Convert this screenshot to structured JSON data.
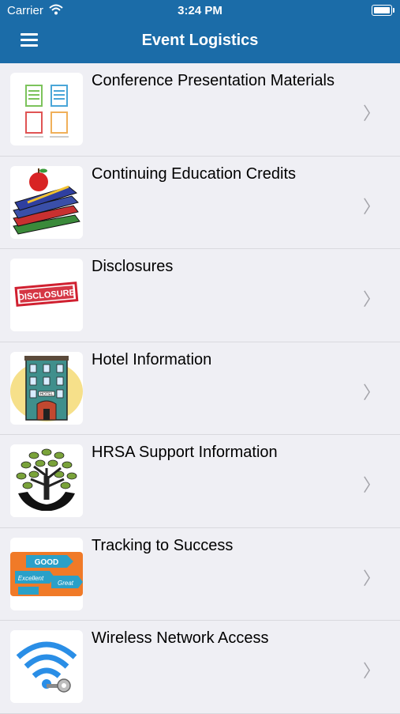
{
  "status_bar": {
    "carrier": "Carrier",
    "time": "3:24 PM"
  },
  "header": {
    "title": "Event Logistics"
  },
  "items": [
    {
      "label": "Conference Presentation Materials"
    },
    {
      "label": "Continuing Education Credits"
    },
    {
      "label": "Disclosures",
      "badge": "DISCLOSURE"
    },
    {
      "label": "Hotel Information",
      "sign": "HOTEL"
    },
    {
      "label": "HRSA Support Information"
    },
    {
      "label": "Tracking to Success",
      "sign_words": [
        "GOOD",
        "Excellent",
        "Great"
      ]
    },
    {
      "label": "Wireless Network Access"
    }
  ],
  "chevron": "〉"
}
